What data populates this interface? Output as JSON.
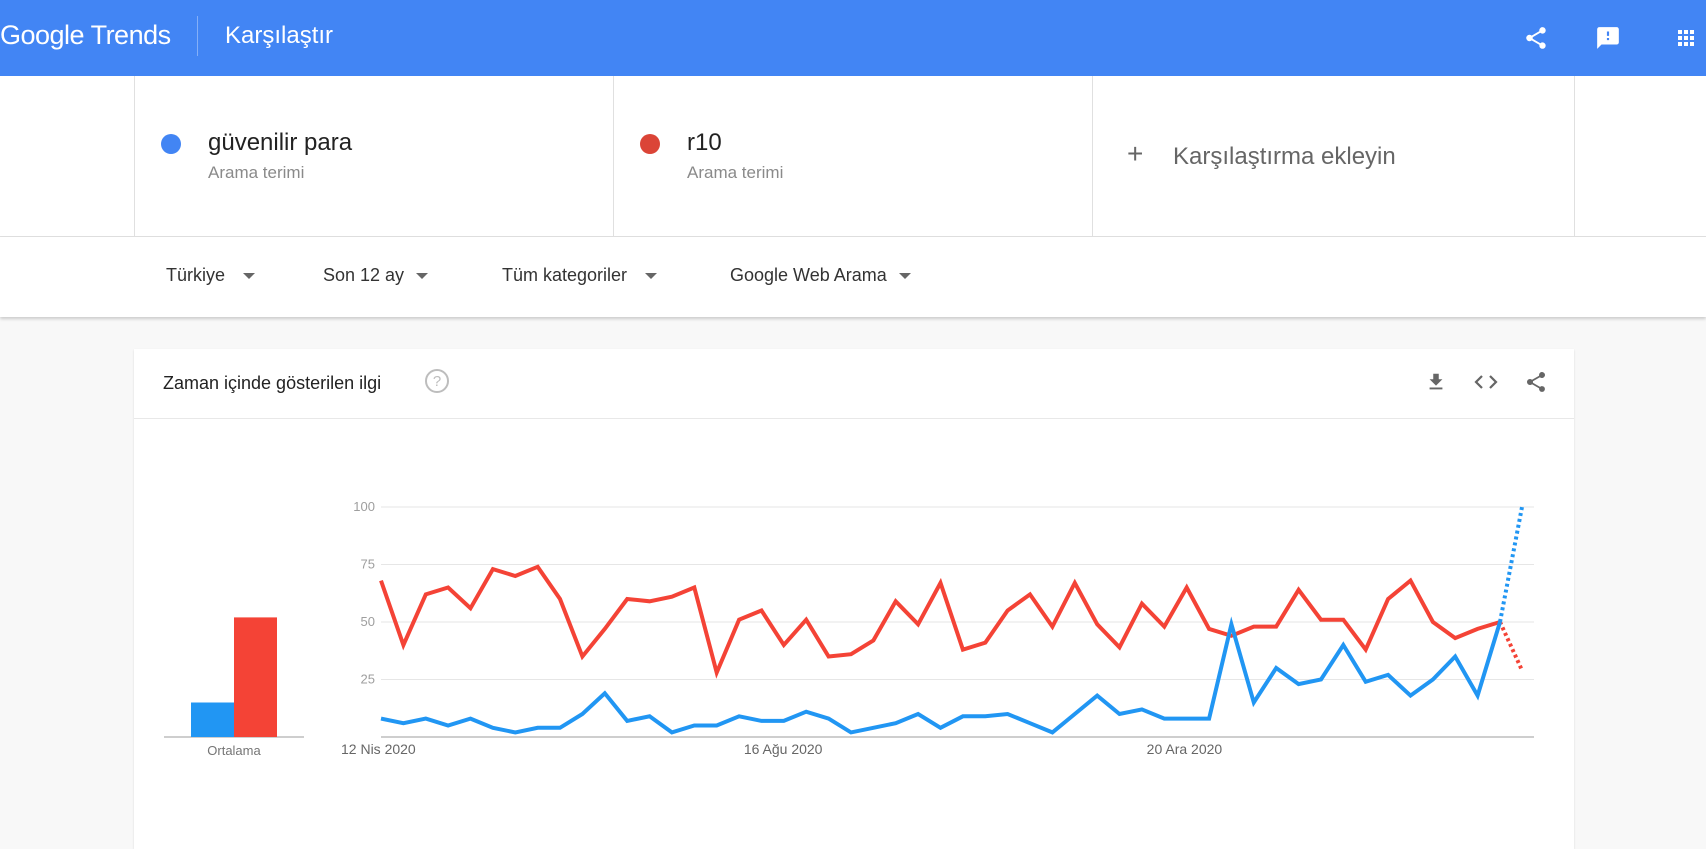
{
  "header": {
    "logo": "Google Trends",
    "title": "Karşılaştır",
    "icons": [
      "share-icon",
      "feedback-icon",
      "apps-icon"
    ]
  },
  "terms": [
    {
      "name": "güvenilir para",
      "subtitle": "Arama terimi",
      "color": "#4285f4"
    },
    {
      "name": "r10",
      "subtitle": "Arama terimi",
      "color": "#db4437"
    }
  ],
  "add_comparison": {
    "label": "Karşılaştırma ekleyin"
  },
  "filters": {
    "region": "Türkiye",
    "time": "Son 12 ay",
    "category": "Tüm kategoriler",
    "search_type": "Google Web Arama"
  },
  "card": {
    "title": "Zaman içinde gösterilen ilgi",
    "icons": [
      "help-icon",
      "download-icon",
      "embed-icon",
      "share-icon"
    ]
  },
  "chart_data": {
    "type": "line",
    "yticks": [
      100,
      75,
      50,
      25
    ],
    "ylim": [
      0,
      100
    ],
    "xtick_labels": [
      {
        "label": "12 Nis 2020",
        "index": 0
      },
      {
        "label": "16 Ağu 2020",
        "index": 18
      },
      {
        "label": "20 Ara 2020",
        "index": 36
      }
    ],
    "average_label": "Ortalama",
    "averages": [
      {
        "name": "güvenilir para",
        "value": 15,
        "color": "#2196f3"
      },
      {
        "name": "r10",
        "value": 52,
        "color": "#f44336"
      }
    ],
    "series": [
      {
        "name": "güvenilir para",
        "color": "#2196f3",
        "values": [
          8,
          6,
          8,
          5,
          8,
          4,
          2,
          4,
          4,
          10,
          19,
          7,
          9,
          2,
          5,
          5,
          9,
          7,
          7,
          11,
          8,
          2,
          4,
          6,
          10,
          4,
          9,
          9,
          10,
          6,
          2,
          10,
          18,
          10,
          12,
          8,
          8,
          8,
          49,
          15,
          30,
          23,
          25,
          40,
          24,
          27,
          18,
          25,
          35,
          18,
          50
        ],
        "partial_end": 100
      },
      {
        "name": "r10",
        "color": "#f44336",
        "values": [
          68,
          40,
          62,
          65,
          56,
          73,
          70,
          74,
          60,
          35,
          47,
          60,
          59,
          61,
          65,
          28,
          51,
          55,
          40,
          51,
          35,
          36,
          42,
          59,
          49,
          67,
          38,
          41,
          55,
          62,
          48,
          67,
          49,
          39,
          58,
          48,
          65,
          47,
          44,
          48,
          48,
          64,
          51,
          51,
          38,
          60,
          68,
          50,
          43,
          47,
          50
        ],
        "partial_end": 29
      }
    ]
  }
}
